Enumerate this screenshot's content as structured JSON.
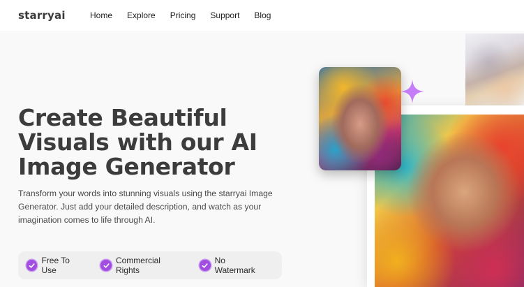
{
  "brand": {
    "logo": "starryai"
  },
  "nav": {
    "items": [
      "Home",
      "Explore",
      "Pricing",
      "Support",
      "Blog"
    ]
  },
  "hero": {
    "title": "Create Beautiful Visuals with our AI Image Generator",
    "description": "Transform your words into stunning visuals using the starryai Image Generator. Just add your detailed description, and watch as your imagination comes to life through AI.",
    "features": [
      "Free To Use",
      "Commercial Rights",
      "No Watermark"
    ]
  },
  "colors": {
    "accent": "#a14de0",
    "text": "#3c3c3c",
    "background": "#f9f9f9"
  },
  "icons": {
    "feature": "check-circle-icon",
    "decoration": "sparkle-icon"
  }
}
